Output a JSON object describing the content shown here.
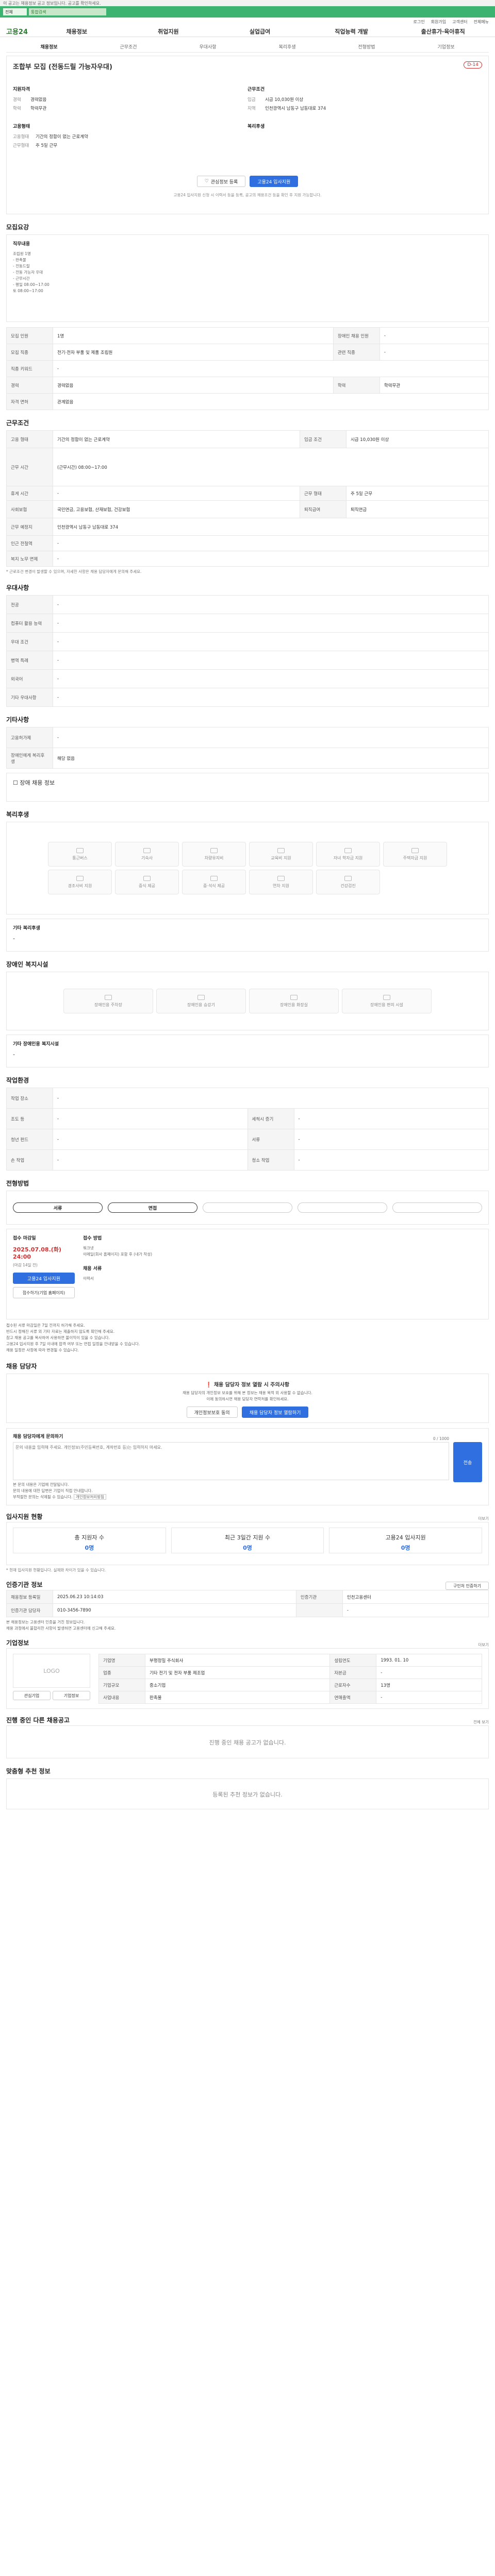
{
  "sticky": {
    "notice": "이 공고는 채용정보 공고 정보입니다. 공고를 확인하세요.",
    "option": "전체",
    "search_text": "통합검색"
  },
  "util": [
    "로그인",
    "회원가입",
    "고객센터",
    "전체메뉴"
  ],
  "gnb": {
    "logo": "고용24",
    "items": [
      "채용정보",
      "취업지원",
      "실업급여",
      "직업능력 개발",
      "출산휴가·육아휴직"
    ]
  },
  "tabs": [
    "채용정보",
    "근무조건",
    "우대사항",
    "복리후생",
    "전형방법",
    "기업정보"
  ],
  "header": {
    "title": "조합부 모집 (전동드릴 가능자우대)",
    "dday": "D-14",
    "left_title": "지원자격",
    "left": [
      [
        "경력",
        "경력없음"
      ],
      [
        "학력",
        "학력무관"
      ]
    ],
    "right_title": "근무조건",
    "right": [
      [
        "임금",
        "시급 10,030원 이상"
      ],
      [
        "지역",
        "인천광역시 남동구 남동대로 374"
      ]
    ],
    "left2_title": "고용형태",
    "left2": [
      [
        "고용형태",
        "기간의 정함이 없는 근로계약"
      ],
      [
        "근무형태",
        "주 5일 근무"
      ]
    ],
    "right2_title": "복리후생",
    "btn_interest": "관심정보 등록",
    "btn_apply": "고용24 입사지원",
    "note": "고용24 입사지원 신청 시 이력서 등을 등록, 공고의 채용조건 등을 확인 후 지원 가능합니다."
  },
  "recruit": {
    "title": "모집요강",
    "duty_title": "직무내용",
    "duties": [
      "조립원 1명",
      "- 판촉물",
      "- 전동드릴",
      "- 전동 가능자 우대",
      "- 근무시간",
      "- 평일 08:00~17:00",
      "토 08:00~17:00"
    ],
    "rows": [
      [
        "모집 인원",
        "1명",
        "장애인 채용 인원",
        "-"
      ],
      [
        "모집 직종",
        "전기·전자 부품 및 제품 조립원",
        "관련 직종",
        "-"
      ],
      [
        "직종 키워드",
        "-",
        "",
        ""
      ],
      [
        "경력",
        "경력없음",
        "학력",
        "학력무관"
      ],
      [
        "자격 면허",
        "관계없음",
        "",
        ""
      ]
    ]
  },
  "conditions": {
    "title": "근무조건",
    "rows": [
      [
        "고용 형태",
        "기간의 정함이 없는 근로계약",
        "임금 조건",
        "시급 10,030원 이상"
      ],
      [
        "근무 시간",
        "(근무시간) 08:00~17:00"
      ],
      [
        "휴게 시간",
        "-",
        "근무 형태",
        "주 5일 근무"
      ],
      [
        "사회보험",
        "국민연금, 고용보험, 산재보험, 건강보험",
        "퇴직급여",
        "퇴직연금"
      ],
      [
        "근무 예정지",
        "인천광역시 남동구 남동대로 374",
        "",
        ""
      ],
      [
        "인근 전철역",
        "-",
        "",
        ""
      ],
      [
        "복지 노무 면제",
        "-",
        "",
        ""
      ]
    ],
    "note": "* 근로조건 변경이 발생할 수 있으며, 자세한 사항은 채용 담당자에게 문의해 주세요."
  },
  "pref": {
    "title": "우대사항",
    "rows": [
      [
        "전공",
        "-"
      ],
      [
        "컴퓨터 활용 능력",
        "-"
      ],
      [
        "우대 조건",
        "-"
      ],
      [
        "병역 특례",
        "-"
      ],
      [
        "외국어",
        "-"
      ],
      [
        "기타 우대사항",
        "-"
      ]
    ]
  },
  "etc": {
    "title": "기타사항",
    "rows": [
      [
        "고용허가제",
        "-"
      ],
      [
        "장애인에게 복리후생",
        "해당 없음"
      ]
    ],
    "disabled": "장애 채용 정보"
  },
  "welfare": {
    "title": "복리후생",
    "items": [
      "통근버스",
      "기숙사",
      "차량유지비",
      "교육비 지원",
      "자녀 학자금 지원",
      "주택자금 지원",
      "경조사비 지원",
      "중식 제공",
      "중·석식 제공",
      "연차 지원",
      "건강검진"
    ],
    "etc_label": "기타 복리후생",
    "etc_value": "-"
  },
  "disab": {
    "title": "장애인 복지시설",
    "items": [
      "장애인용 주차장",
      "장애인용 승강기",
      "장애인용 화장실",
      "장애인용 편의 시설"
    ],
    "etc_label": "기타 장애인용 복지시설",
    "etc_value": "-"
  },
  "work": {
    "title": "작업환경",
    "rows": [
      [
        "작업 장소",
        "-",
        "",
        ""
      ],
      [
        "조도 등",
        "-",
        "세척시 증기",
        "-"
      ],
      [
        "청년 펀드",
        "-",
        "서류",
        "-"
      ],
      [
        "손 작업",
        "-",
        "청소 작업",
        "-"
      ]
    ]
  },
  "method": {
    "title": "전형방법",
    "steps": [
      "서류",
      "면접",
      "",
      "",
      ""
    ],
    "deadline_label": "접수 마감일",
    "deadline": "2025.07.08.(화) 24:00",
    "remain": "(마감 14일 전)",
    "btn_apply": "고용24 입사지원",
    "btn_home": "접수하기(기업 홈페이지)",
    "doc_label": "접수 방법",
    "docs": [
      "워크넷",
      "이메일(회사 홈페이지) 포함 후 (내가 작성)"
    ],
    "result_label": "채용 서류",
    "result": "이력서",
    "notes": [
      "접수된 서류 마감일은 7일 전까지 허가해 주세요.",
      "반드시 정해진 서류 외 기타 자료는 제출하지 않도록 확인해 주세요.",
      "참고 채용 공고를 복사하여 사용하면 불이익이 있을 수 있습니다.",
      "고용24 입사지원 후 7일 이내에 합격 여부 또는 면접 일정을 안내받을 수 있습니다.",
      "채용 일정은 사정에 따라 변경될 수 있습니다."
    ]
  },
  "manager": {
    "title": "채용 담당자",
    "warn_title": "채용 담당자 정보 열람 시 주의사항",
    "warn_body": "채용 담당자의 개인정보 보호를 위해 본 정보는 채용 목적 외 사용할 수 없습니다.",
    "warn_body2": "이에 동의하시면 채용 담당자 연락처를 확인하세요.",
    "btn_see": "개인정보보호 동의",
    "btn_show": "채용 담당자 정보 열람하기",
    "q_title": "채용 담당자에게 문의하기",
    "q_placeholder": "문의 내용을 입력해 주세요. 개인정보(주민등록번호, 계좌번호 등)는 입력하지 마세요.",
    "q_count": "0 / 1000",
    "q_btn": "전송",
    "q_notes": [
      "본 문의 내용은 기업에 전달됩니다.",
      "문의 내용에 대한 답변은 기업이 직접 안내합니다.",
      "부적절한 문의는 삭제될 수 있습니다."
    ],
    "q_link": "개인정보처리방침"
  },
  "stats": {
    "title": "입사지원 현황",
    "more": "더보기",
    "items": [
      [
        "총 지원자 수",
        "0명"
      ],
      [
        "최근 3일간 지원 수",
        "0명"
      ],
      [
        "고용24 입사지원",
        "0명"
      ]
    ],
    "note": "* 현재 입사지원 현황입니다. 실제와 차이가 있을 수 있습니다."
  },
  "agency": {
    "title": "인증기관 정보",
    "btn": "구인처 인증하기",
    "rows": [
      [
        "채용정보 등록일",
        "2025.06.23 10:14:03",
        "인증기관",
        "인천고용센터"
      ],
      [
        "인증기관 담당자",
        "010-3456-7890",
        "",
        "-"
      ]
    ],
    "notes": [
      "본 채용정보는 고용센터 인증을 거친 정보입니다.",
      "채용 과정에서 불합리한 사항이 발생하면 고용센터에 신고해 주세요."
    ]
  },
  "company": {
    "title": "기업정보",
    "more": "더보기",
    "logo": "LOGO",
    "btn_fav": "관심기업",
    "btn_info": "기업정보",
    "rows": [
      [
        "기업명",
        "부평정밀 주식회사",
        "설립연도",
        "1993. 01. 10"
      ],
      [
        "업종",
        "기타 전기 및 전자 부품 제조업",
        "자본금",
        "-"
      ],
      [
        "기업규모",
        "중소기업",
        "근로자수",
        "13명"
      ],
      [
        "사업내용",
        "판촉물",
        "연매출액",
        "-"
      ]
    ]
  },
  "other": {
    "title": "진행 중인 다른 채용공고",
    "empty": "진행 중인 채용 공고가 없습니다.",
    "more": "전체 보기"
  },
  "rec": {
    "title": "맞춤형 추천 정보",
    "empty": "등록된 추천 정보가 없습니다."
  }
}
